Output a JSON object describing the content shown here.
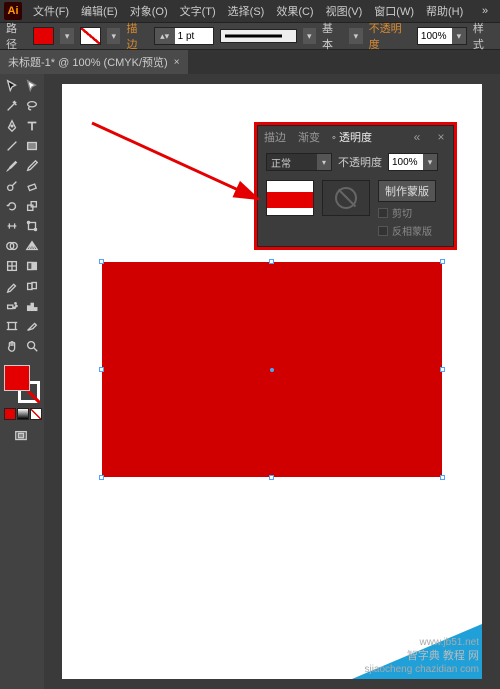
{
  "app": {
    "logo": "Ai"
  },
  "menu": {
    "file": "文件(F)",
    "edit": "编辑(E)",
    "object": "对象(O)",
    "type": "文字(T)",
    "select": "选择(S)",
    "effect": "效果(C)",
    "view": "视图(V)",
    "window": "窗口(W)",
    "help": "帮助(H)"
  },
  "ctrl": {
    "label_left": "路径",
    "stroke_width": "1 pt",
    "basic": "基本",
    "opacity_label": "不透明度",
    "opacity_value": "100%",
    "style_label": "样式"
  },
  "doc_tab": {
    "title": "未标题-1* @ 100% (CMYK/预览)",
    "close": "×"
  },
  "panel": {
    "tabs": {
      "stroke": "描边",
      "gradient": "渐变",
      "transparency": "◦ 透明度"
    },
    "blend_mode": "正常",
    "opacity_label": "不透明度",
    "opacity_value": "100%",
    "make_mask": "制作蒙版",
    "clip": "剪切",
    "invert": "反相蒙版"
  },
  "watermark": {
    "line1": "www.jb51.net",
    "line2": "智字典 教程 网",
    "line3": "sjiaocheng chazidian com"
  },
  "chev": "»",
  "arrow_down": "▾"
}
